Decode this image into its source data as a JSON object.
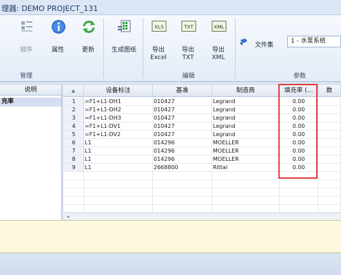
{
  "window": {
    "title": "理器: DEMO PROJECT_131"
  },
  "ribbon": {
    "groups": {
      "manage": "管理",
      "edit": "编辑",
      "params": "参数"
    },
    "buttons": {
      "order": "顺序",
      "properties": "属性",
      "update": "更新",
      "generate_drawing": "生成图纸",
      "export_excel_1": "导出",
      "export_excel_2": "Excel",
      "export_txt_1": "导出",
      "export_txt_2": "TXT",
      "export_xml_1": "导出",
      "export_xml_2": "XML"
    },
    "icon_text": {
      "xls": "XLS",
      "txt": "TXT",
      "xml": "XML"
    },
    "file_label": "文件集",
    "file_value": "1 - 水泵系统"
  },
  "left_pane": {
    "header": "说明",
    "selected": "充率"
  },
  "grid": {
    "headers": {
      "device_tag": "设备标注",
      "reference": "基准",
      "manufacturer": "制造商",
      "fill_rate": "填充率 (...",
      "extra": "数"
    },
    "rows": [
      {
        "n": "1",
        "tag": "=F1+L1-DH1",
        "ref": "010427",
        "mfr": "Legrand",
        "fill": "0.00"
      },
      {
        "n": "2",
        "tag": "=F1+L1-DH2",
        "ref": "010427",
        "mfr": "Legrand",
        "fill": "0.00"
      },
      {
        "n": "3",
        "tag": "=F1+L1-DH3",
        "ref": "010427",
        "mfr": "Legrand",
        "fill": "0.00"
      },
      {
        "n": "4",
        "tag": "=F1+L1-DV1",
        "ref": "010427",
        "mfr": "Legrand",
        "fill": "0.00"
      },
      {
        "n": "5",
        "tag": "=F1+L1-DV2",
        "ref": "010427",
        "mfr": "Legrand",
        "fill": "0.00"
      },
      {
        "n": "6",
        "tag": "L1",
        "ref": "014296",
        "mfr": "MOELLER",
        "fill": "0.00"
      },
      {
        "n": "7",
        "tag": "L1",
        "ref": "014296",
        "mfr": "MOELLER",
        "fill": "0.00"
      },
      {
        "n": "8",
        "tag": "L1",
        "ref": "014296",
        "mfr": "MOELLER",
        "fill": "0.00"
      },
      {
        "n": "9",
        "tag": "L1",
        "ref": "2668800",
        "mfr": "Rittal",
        "fill": "0.00"
      }
    ]
  },
  "colors": {
    "highlight_box": "#e23a3a",
    "notes_bg": "#fcf9de"
  }
}
